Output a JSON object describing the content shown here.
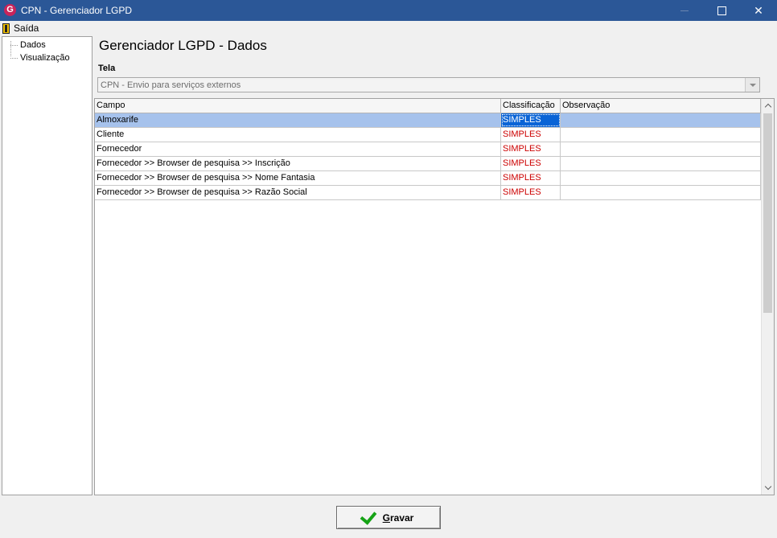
{
  "window": {
    "title": "CPN - Gerenciador LGPD",
    "app_icon_glyph": "G",
    "icons": {
      "app": "app-logo-icon",
      "minimize": "minimize-icon",
      "maximize": "maximize-icon",
      "close": "close-icon"
    },
    "close_glyph": "✕"
  },
  "menu": {
    "exit_label": "Saída",
    "exit_icon": "exit-door-icon"
  },
  "tree": {
    "items": [
      {
        "label": "Dados"
      },
      {
        "label": "Visualização"
      }
    ]
  },
  "main": {
    "title": "Gerenciador LGPD - Dados",
    "tela_label": "Tela",
    "tela_value": "CPN - Envio para serviços externos"
  },
  "grid": {
    "columns": [
      "Campo",
      "Classificação",
      "Observação"
    ],
    "rows": [
      {
        "campo": "Almoxarife",
        "classificacao": "SIMPLES",
        "observacao": ""
      },
      {
        "campo": "Cliente",
        "classificacao": "SIMPLES",
        "observacao": ""
      },
      {
        "campo": "Fornecedor",
        "classificacao": "SIMPLES",
        "observacao": ""
      },
      {
        "campo": "Fornecedor >> Browser de pesquisa >> Inscrição",
        "classificacao": "SIMPLES",
        "observacao": ""
      },
      {
        "campo": "Fornecedor >> Browser de pesquisa >> Nome Fantasia",
        "classificacao": "SIMPLES",
        "observacao": ""
      },
      {
        "campo": "Fornecedor >> Browser de pesquisa >> Razão Social",
        "classificacao": "SIMPLES",
        "observacao": ""
      }
    ],
    "selected_row": 0
  },
  "footer": {
    "save_first_letter": "G",
    "save_rest": "ravar",
    "save_icon": "checkmark-icon"
  },
  "colors": {
    "titlebar": "#2b5797",
    "selection": "#a6c2ec",
    "focus_cell": "#0a64d6",
    "classification_text": "#cc0000",
    "check": "#16a316"
  }
}
